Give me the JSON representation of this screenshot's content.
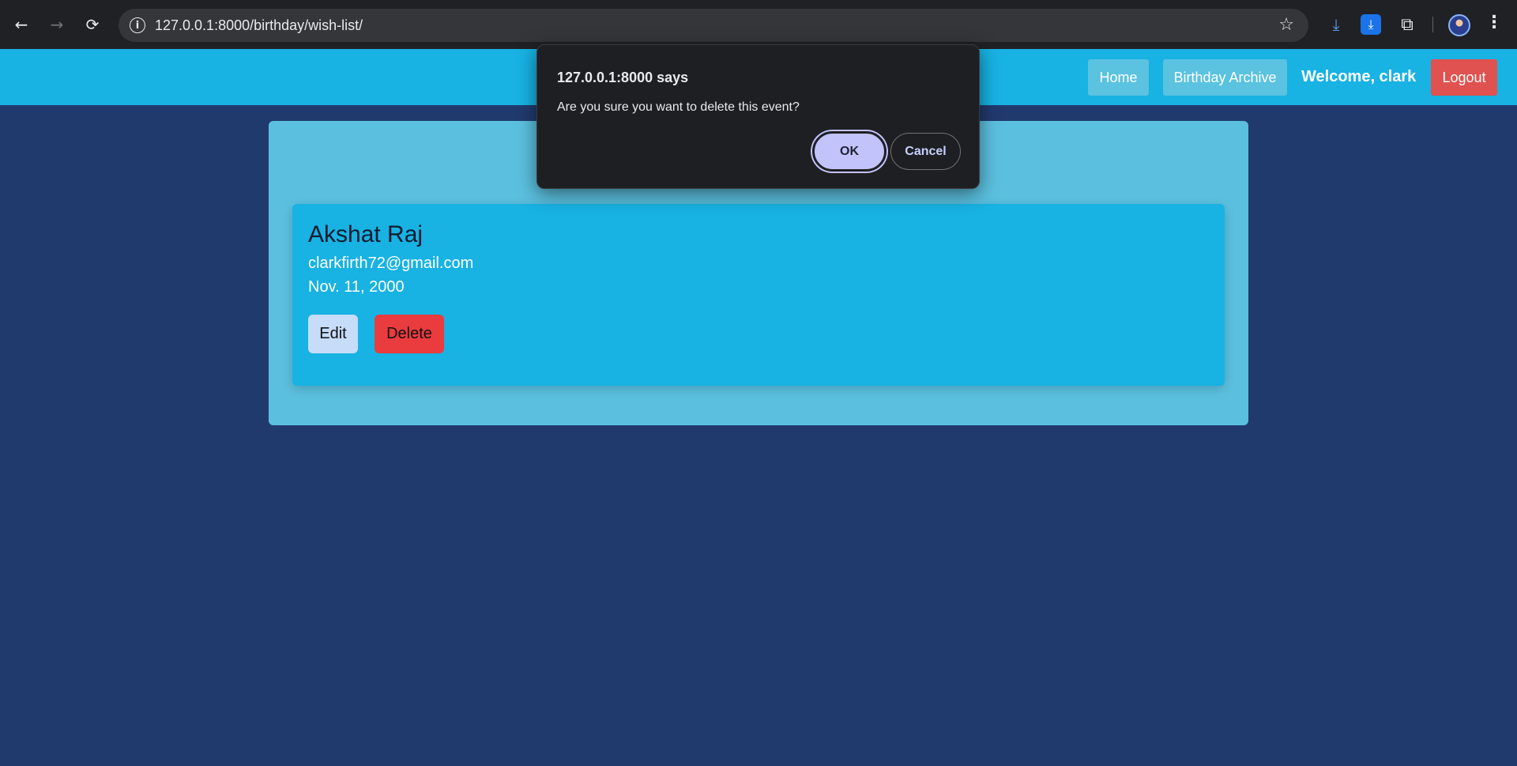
{
  "browser": {
    "back_icon": "←",
    "forward_icon": "→",
    "reload_icon": "⟳",
    "site_info_icon": "i",
    "url": "127.0.0.1:8000/birthday/wish-list/",
    "star_icon": "☆",
    "download_icon": "⤓",
    "download_active_icon": "⤓",
    "extensions_icon": "⧉",
    "menu_icon": "⋮"
  },
  "navbar": {
    "home_label": "Home",
    "archive_label": "Birthday Archive",
    "welcome_text": "Welcome, clark",
    "logout_label": "Logout"
  },
  "event": {
    "name": "Akshat Raj",
    "email": "clarkfirth72@gmail.com",
    "date": "Nov. 11, 2000",
    "edit_label": "Edit",
    "delete_label": "Delete"
  },
  "dialog": {
    "title": "127.0.0.1:8000 says",
    "message": "Are you sure you want to delete this event?",
    "ok_label": "OK",
    "cancel_label": "Cancel"
  },
  "colors": {
    "page_bg": "#213a6e",
    "navbar_bg": "#18b2e3",
    "panel_bg": "#5bc0df",
    "card_bg": "#18b2e3",
    "logout_bg": "#e0524f",
    "delete_bg": "#ea3b3f",
    "edit_bg": "#c6dcf8",
    "dialog_bg": "#1e1f22",
    "ok_bg": "#c2c3fb"
  }
}
